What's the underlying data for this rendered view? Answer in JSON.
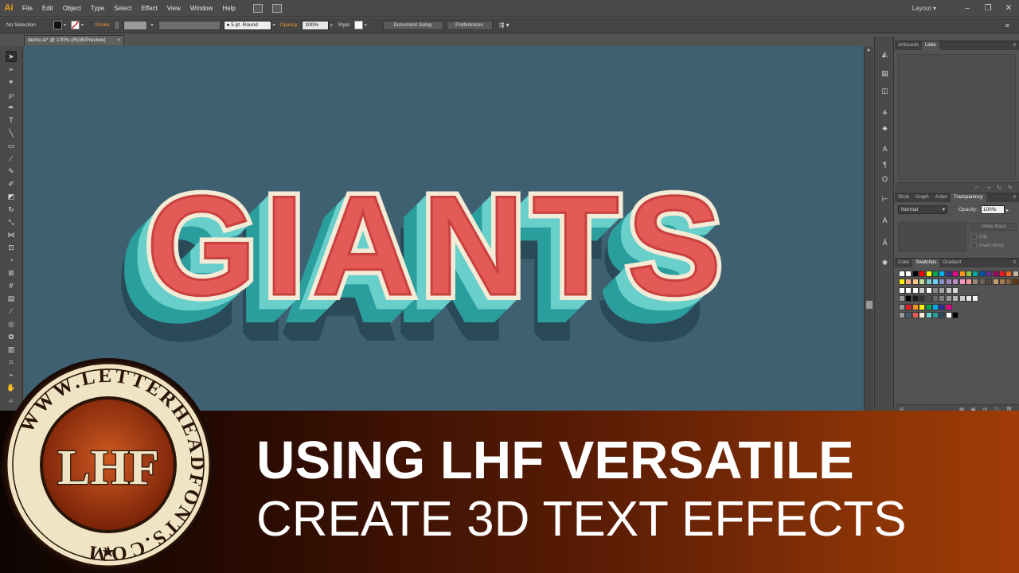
{
  "app": {
    "logo": "Ai",
    "menus": [
      "File",
      "Edit",
      "Object",
      "Type",
      "Select",
      "Effect",
      "View",
      "Window",
      "Help"
    ],
    "workspace": "Layout"
  },
  "control_bar": {
    "selection": "No Selection",
    "stroke_label": "Stroke:",
    "brush": "5 pt. Round",
    "opacity_label": "Opacity:",
    "opacity_value": "100%",
    "style_label": "Style:",
    "document_setup": "Document Setup",
    "preferences": "Preferences"
  },
  "document": {
    "tab_title": "demo.ai* @ 100% (RGB/Preview)"
  },
  "artwork": {
    "text": "GIANTS",
    "colors": {
      "canvas": "#3e6070",
      "face": "#e35a57",
      "inline": "#c9413f",
      "outline": "#f3ebd6",
      "extrude_light": "#69cfcb",
      "extrude_dark": "#2a9e9c",
      "shadow": "#2b4a58"
    }
  },
  "panels": {
    "top_tabs": [
      "Artboards",
      "Links"
    ],
    "top_active": "Links",
    "mid_tabs": [
      "Strok",
      "Graph",
      "Actior",
      "Transparency"
    ],
    "mid_active": "Transparency",
    "blend_mode": "Normal",
    "opacity_label": "Opacity:",
    "opacity_value": "100%",
    "make_mask": "Make Mask",
    "clip": "Clip",
    "invert_mask": "Invert Mask",
    "bottom_tabs": [
      "Color",
      "Swatches",
      "Gradient"
    ],
    "bottom_active": "Swatches"
  },
  "banner": {
    "headline": "USING LHF VERSATILE",
    "subline": "CREATE 3D TEXT EFFECTS",
    "seal_text": "WWW.LETTERHEADFONTS.COM",
    "seal_monogram": "LHF",
    "colors": {
      "headline": "#ffffff",
      "seal_ring": "#efe4c4",
      "seal_center": "#b6441a"
    }
  }
}
